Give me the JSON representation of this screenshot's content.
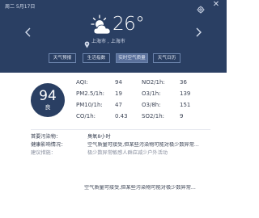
{
  "header": {
    "date": "周二 5月17日",
    "temperature": "26°",
    "location": "上海市 , 上海市",
    "icons": {
      "weather": "partly-cloudy-sun-icon",
      "location": "location-pin-icon",
      "settings": "gear-icon",
      "close": "close-icon",
      "prev": "chevron-left-icon",
      "next": "chevron-right-icon"
    },
    "tabs": [
      {
        "label": "天气预报"
      },
      {
        "label": "生活指数"
      },
      {
        "label": "实时空气质量"
      },
      {
        "label": "天气日历"
      }
    ],
    "active_tab": "实时空气质量"
  },
  "air": {
    "aqi_value": "94",
    "aqi_level": "良",
    "metrics": [
      {
        "label": "AQI:",
        "value": "94"
      },
      {
        "label": "NO2/1h:",
        "value": "36"
      },
      {
        "label": "PM2.5/1h:",
        "value": "19"
      },
      {
        "label": "O3/1h:",
        "value": "139"
      },
      {
        "label": "PM10/1h:",
        "value": "47"
      },
      {
        "label": "O3/8h:",
        "value": "151"
      },
      {
        "label": "CO/1h:",
        "value": "0.43"
      },
      {
        "label": "SO2/1h:",
        "value": "9"
      }
    ]
  },
  "details": {
    "primary_pollutant_label": "首要污染物：",
    "primary_pollutant_value": "臭氧8小时",
    "health_label": "健康影响情况：",
    "health_value": "空气质量可接受,但某些污染物可能对极少数异常...",
    "advice_label": "建议措施：",
    "advice_value": "极少数异常敏感人群应减少户外活动",
    "extra_value": "空气质量可接受,但某些污染物可能对极少数异常..."
  },
  "colors": {
    "header_bg": "#2a3f63",
    "accent": "#2a3f63"
  }
}
